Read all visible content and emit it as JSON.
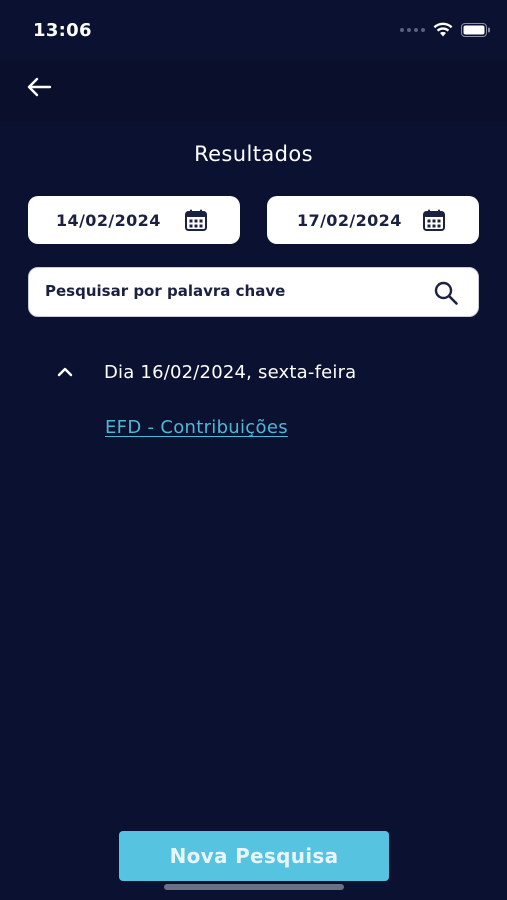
{
  "status_bar": {
    "time": "13:06",
    "icons": [
      "signal-dots-icon",
      "wifi-icon",
      "battery-icon"
    ]
  },
  "header": {
    "back_icon": "arrow-left-icon",
    "title": "Resultados"
  },
  "filters": {
    "start_date": "14/02/2024",
    "end_date": "17/02/2024",
    "calendar_icon": "calendar-icon"
  },
  "search": {
    "placeholder": "Pesquisar por palavra chave",
    "value": "",
    "icon": "search-icon"
  },
  "results": {
    "groups": [
      {
        "expanded": true,
        "day_label": "Dia 16/02/2024, sexta-feira",
        "items": [
          {
            "label": "EFD - Contribuições"
          }
        ]
      }
    ]
  },
  "footer": {
    "new_search_label": "Nova Pesquisa"
  },
  "colors": {
    "background": "#0b1130",
    "accent": "#56c3e0",
    "link": "#4fb8d6",
    "field_text": "#1b2140"
  }
}
